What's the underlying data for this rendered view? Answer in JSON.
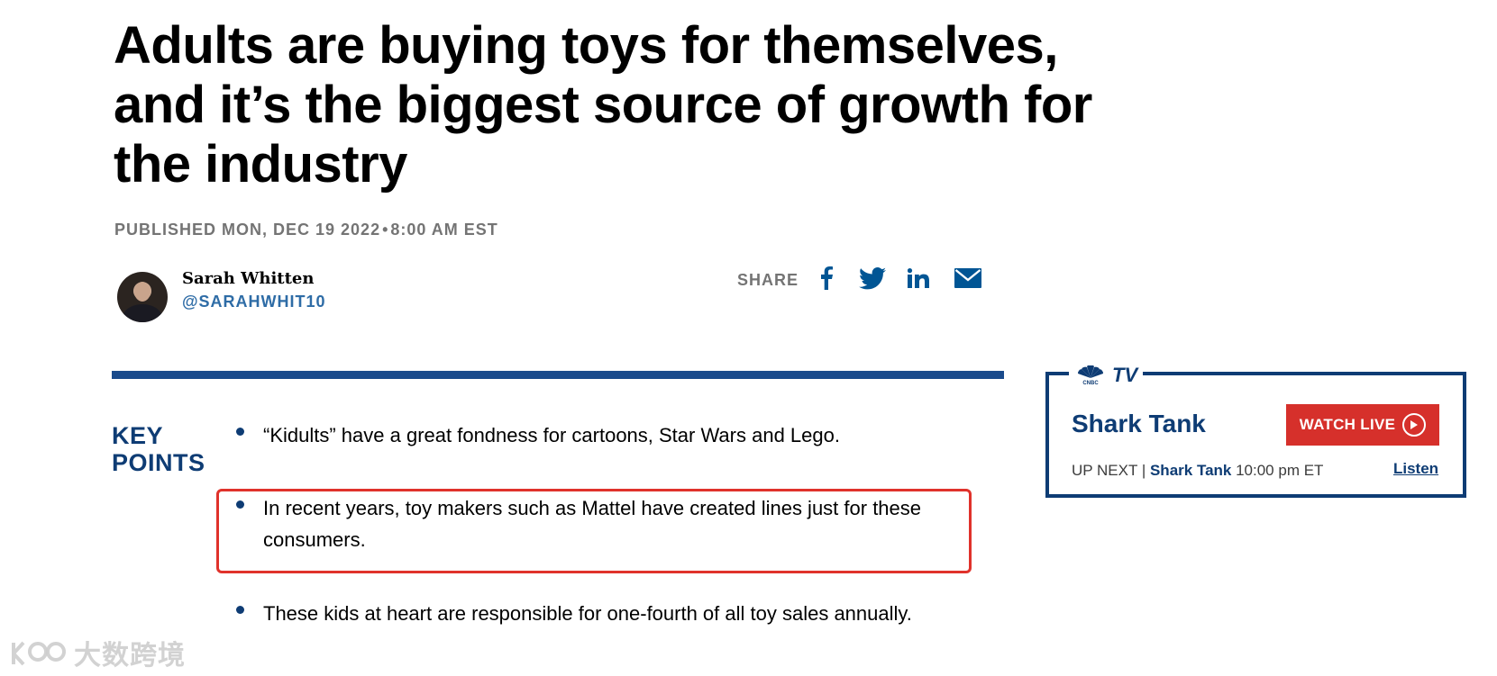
{
  "article": {
    "headline": "Adults are buying toys for themselves, and it’s the biggest source of growth for the industry",
    "published_label": "PUBLISHED MON, DEC 19 2022",
    "published_sep": "•",
    "published_time": "8:00 AM EST"
  },
  "author": {
    "name": "Sarah Whitten",
    "handle": "@SARAHWHIT10"
  },
  "share": {
    "label": "SHARE",
    "icons": [
      "facebook-icon",
      "twitter-icon",
      "linkedin-icon",
      "email-icon"
    ]
  },
  "key_points": {
    "title_line1": "KEY",
    "title_line2": "POINTS",
    "items": [
      "“Kidults” have a great fondness for cartoons, Star Wars and Lego.",
      "In recent years, toy makers such as Mattel have created lines just for these consumers.",
      "These kids at heart are responsible for one-fourth of all toy sales annually."
    ]
  },
  "tv_widget": {
    "logo_text": "TV",
    "show_title": "Shark Tank",
    "watch_label": "WATCH LIVE",
    "up_next_label": "UP NEXT",
    "up_next_sep": "|",
    "up_next_show": "Shark Tank",
    "up_next_time": "10:00 pm ET",
    "listen_label": "Listen"
  },
  "watermark": {
    "text": "大数跨境"
  },
  "colors": {
    "brand_blue": "#0e3c74",
    "link_blue": "#2e6ca6",
    "share_blue": "#005594",
    "watch_red": "#d6302b",
    "highlight_red": "#e0322b",
    "meta_gray": "#747474"
  }
}
